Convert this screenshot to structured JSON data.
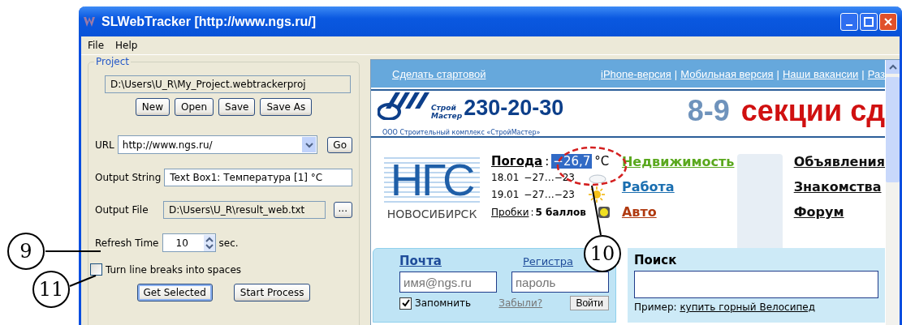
{
  "window": {
    "title": "SLWebTracker [http://www.ngs.ru/]"
  },
  "menu": [
    "File",
    "Help"
  ],
  "project": {
    "title": "Project",
    "path": "D:\\Users\\U_R\\My_Project.webtrackerproj",
    "buttons": [
      "New",
      "Open",
      "Save",
      "Save As"
    ]
  },
  "form": {
    "url_label": "URL",
    "url": "http://www.ngs.ru/",
    "go": "Go",
    "output_string_label": "Output String",
    "output_string": "Text Box1: Температура [1] °C",
    "output_file_label": "Output File",
    "output_file": "D:\\Users\\U_R\\result_web.txt",
    "browse": "...",
    "refresh_label": "Refresh Time",
    "refresh": "10",
    "refresh_unit": "sec.",
    "line_breaks": {
      "label": "Turn line breaks into spaces",
      "checked": false
    },
    "buttons": [
      {
        "label": "Get Selected",
        "focused": true
      },
      {
        "label": "Start Process",
        "focused": false
      }
    ]
  },
  "browser": {
    "start_link": "Сделать стартовой",
    "separator": "|",
    "top_links": [
      "iPhone-версия",
      "Мобильная версия",
      "Наши вакансии",
      "Раз"
    ],
    "banner": {
      "logo_words": [
        "Строй",
        "Мастер"
      ],
      "phone": "230-20-30",
      "company": "ООО Строительный комплекс «СтройМастер»",
      "promo_number": "8-9",
      "promo_text": "секции сд"
    },
    "site": {
      "logo": "НГС",
      "city": "НОВОСИБИРСК"
    },
    "weather": {
      "label": "Погода",
      "suffix": ":",
      "temperature": "−26,7",
      "unit": "°C",
      "forecast": [
        {
          "date": "18.01",
          "range": "−27…−23",
          "kind": "cloudy"
        },
        {
          "date": "19.01",
          "range": "−27…−23",
          "kind": "sunny"
        }
      ],
      "traffic_label": "Пробки",
      "traffic_suffix": ":",
      "traffic_value": "5 баллов"
    },
    "sections": [
      {
        "label": "Недвижимость",
        "color": "#5aa81e"
      },
      {
        "label": "Работа",
        "color": "#1a6eb0"
      },
      {
        "label": "Авто",
        "color": "#b03a10"
      }
    ],
    "more_sections": [
      "Объявления",
      "Знакомства",
      "Форум"
    ],
    "mail": {
      "title": "Почта",
      "register": "Регистра",
      "email_placeholder": "имя@ngs.ru",
      "password_placeholder": "пароль",
      "remember": {
        "label": "Запомнить",
        "checked": true
      },
      "forgot": "Забыли?",
      "login": "Войти"
    },
    "search": {
      "title": "Поиск",
      "example_label": "Пример:",
      "example": "купить горный Велосипед"
    }
  },
  "callouts": [
    {
      "label": "9"
    },
    {
      "label": "11"
    },
    {
      "label": "10"
    }
  ]
}
